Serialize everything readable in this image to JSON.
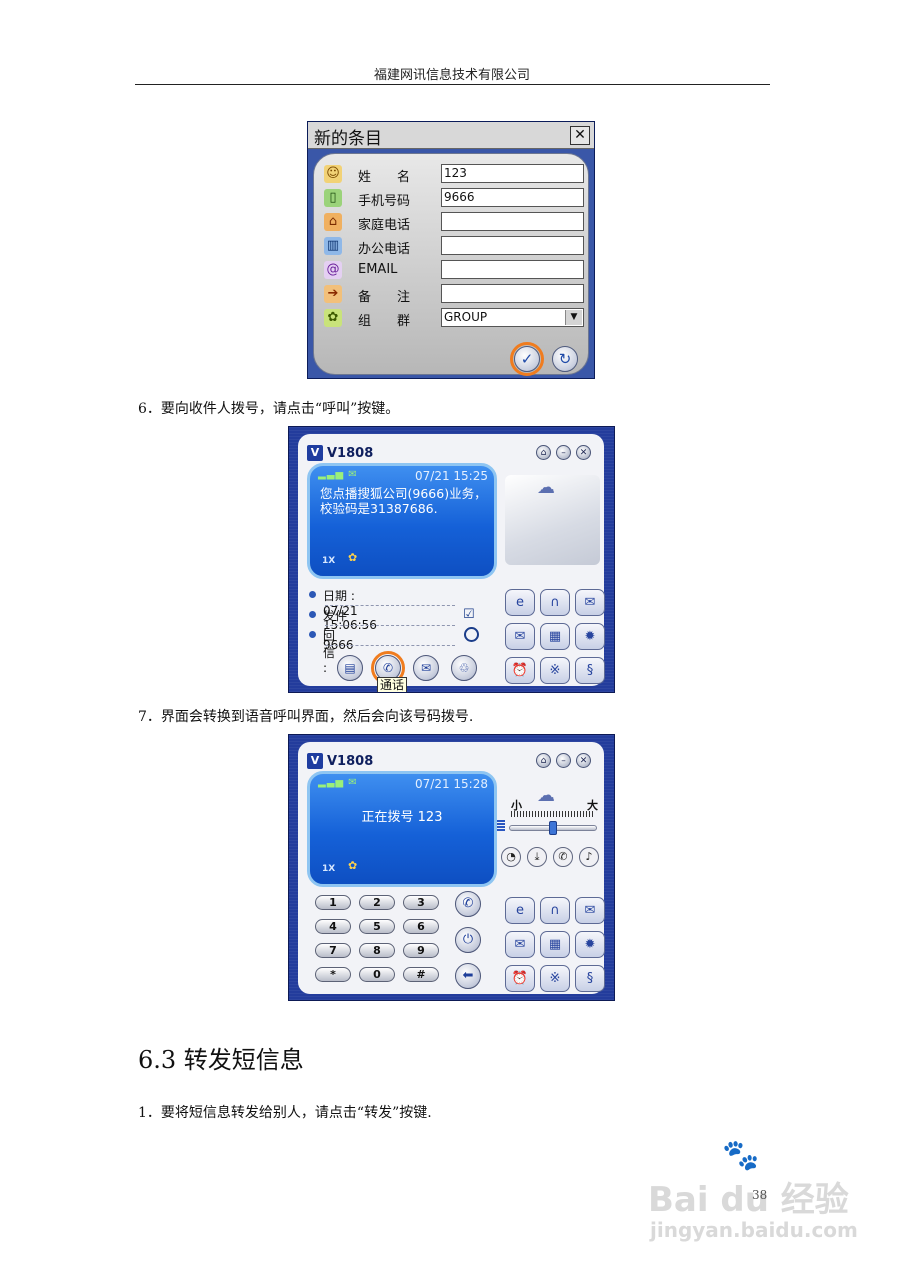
{
  "header": {
    "company": "福建网讯信息技术有限公司"
  },
  "dialog": {
    "title": "新的条目",
    "close_glyph": "✕",
    "fields": [
      {
        "label": "姓　　名",
        "value": "123",
        "icon": "person-icon"
      },
      {
        "label": "手机号码",
        "value": "9666",
        "icon": "mobile-phone-icon"
      },
      {
        "label": "家庭电话",
        "value": "",
        "icon": "home-icon"
      },
      {
        "label": "办公电话",
        "value": "",
        "icon": "office-building-icon"
      },
      {
        "label": "EMAIL",
        "value": "",
        "icon": "at-sign-icon"
      },
      {
        "label": "备　　注",
        "value": "",
        "icon": "signpost-icon"
      },
      {
        "label": "组　　群",
        "value": "GROUP",
        "icon": "group-icon"
      }
    ],
    "confirm_glyph": "✓",
    "reset_glyph": "↻"
  },
  "step6": {
    "text": "6．要向收件人拨号，请点击“呼叫”按键。"
  },
  "phone1": {
    "brand": "V1808",
    "time": "07/21 15:25",
    "message": "您点播搜狐公司(9666)业务，校验码是31387686.",
    "mode": "1X",
    "date_row": "日期 : 07/21 15:06:56",
    "sender_row": "发件 : 9666",
    "reply_row": "回信 :",
    "tooltip": "通话"
  },
  "step7": {
    "text": "7．界面会转换到语音呼叫界面，然后会向该号码拨号."
  },
  "phone2": {
    "brand": "V1808",
    "time": "07/21 15:28",
    "status": "正在拨号 123",
    "mode": "1X",
    "vol_small": "小",
    "vol_large": "大",
    "keys": [
      "1",
      "2",
      "3",
      "4",
      "5",
      "6",
      "7",
      "8",
      "9",
      "*",
      "0",
      "#"
    ]
  },
  "section": {
    "title": "6.3  转发短信息"
  },
  "step1": {
    "text": "1．要将短信息转发给别人，请点击“转发”按键."
  },
  "page_number": "38",
  "watermark": {
    "brand": "Bai du 经验",
    "url": "jingyan.baidu.com"
  },
  "colors": {
    "panel_blue": "#233c9c",
    "screen_blue": "#1561d8",
    "highlight": "#f07c1e"
  }
}
